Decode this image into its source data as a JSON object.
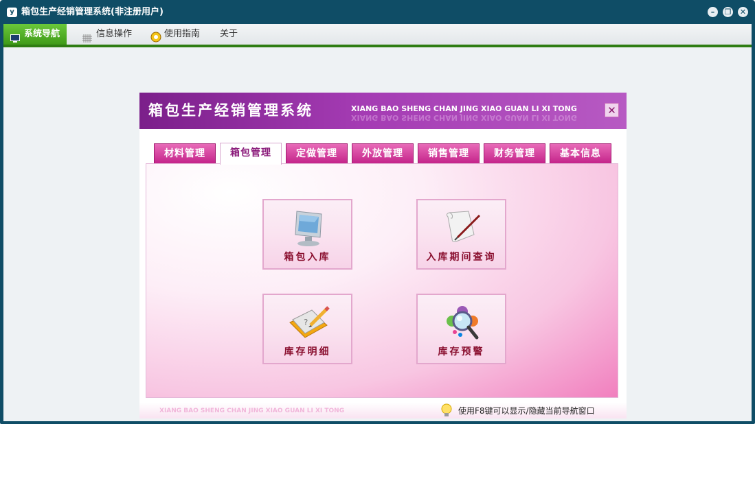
{
  "window": {
    "title": "箱包生产经销管理系统(非注册用户)",
    "app_icon": "y",
    "controls": [
      "minimize-icon",
      "restore-icon",
      "close-icon"
    ]
  },
  "menu": {
    "items": [
      {
        "label": "系统导航",
        "icon": "monitor-icon",
        "active": true
      },
      {
        "label": "信息操作",
        "icon": "grid-icon",
        "active": false
      },
      {
        "label": "使用指南",
        "icon": "guide-icon",
        "active": false
      },
      {
        "label": "关于",
        "icon": "",
        "active": false
      }
    ]
  },
  "panel": {
    "title": "箱包生产经销管理系统",
    "subtitle": "XIANG BAO SHENG CHAN JING XIAO GUAN LI XI TONG",
    "close_symbol": "✕",
    "tabs": [
      {
        "label": "材料管理",
        "active": false
      },
      {
        "label": "箱包管理",
        "active": true
      },
      {
        "label": "定做管理",
        "active": false
      },
      {
        "label": "外放管理",
        "active": false
      },
      {
        "label": "销售管理",
        "active": false
      },
      {
        "label": "财务管理",
        "active": false
      },
      {
        "label": "基本信息",
        "active": false
      }
    ],
    "buttons": [
      {
        "label": "箱包入库",
        "icon": "monitor-icon"
      },
      {
        "label": "入库期间查询",
        "icon": "scroll-quill-icon"
      },
      {
        "label": "库存明细",
        "icon": "notebook-pencil-icon"
      },
      {
        "label": "库存预警",
        "icon": "magnifier-icon"
      }
    ],
    "footer": {
      "left_text": "XIANG BAO SHENG CHAN JING XIAO GUAN LI XI TONG",
      "hint": "使用F8键可以显示/隐藏当前导航窗口"
    }
  },
  "colors": {
    "window_frame": "#0f4d66",
    "menu_active": "#4caf22",
    "header_purple": "#8e2a9c",
    "tab_pink": "#d63c9e",
    "label_red": "#8a1030"
  }
}
